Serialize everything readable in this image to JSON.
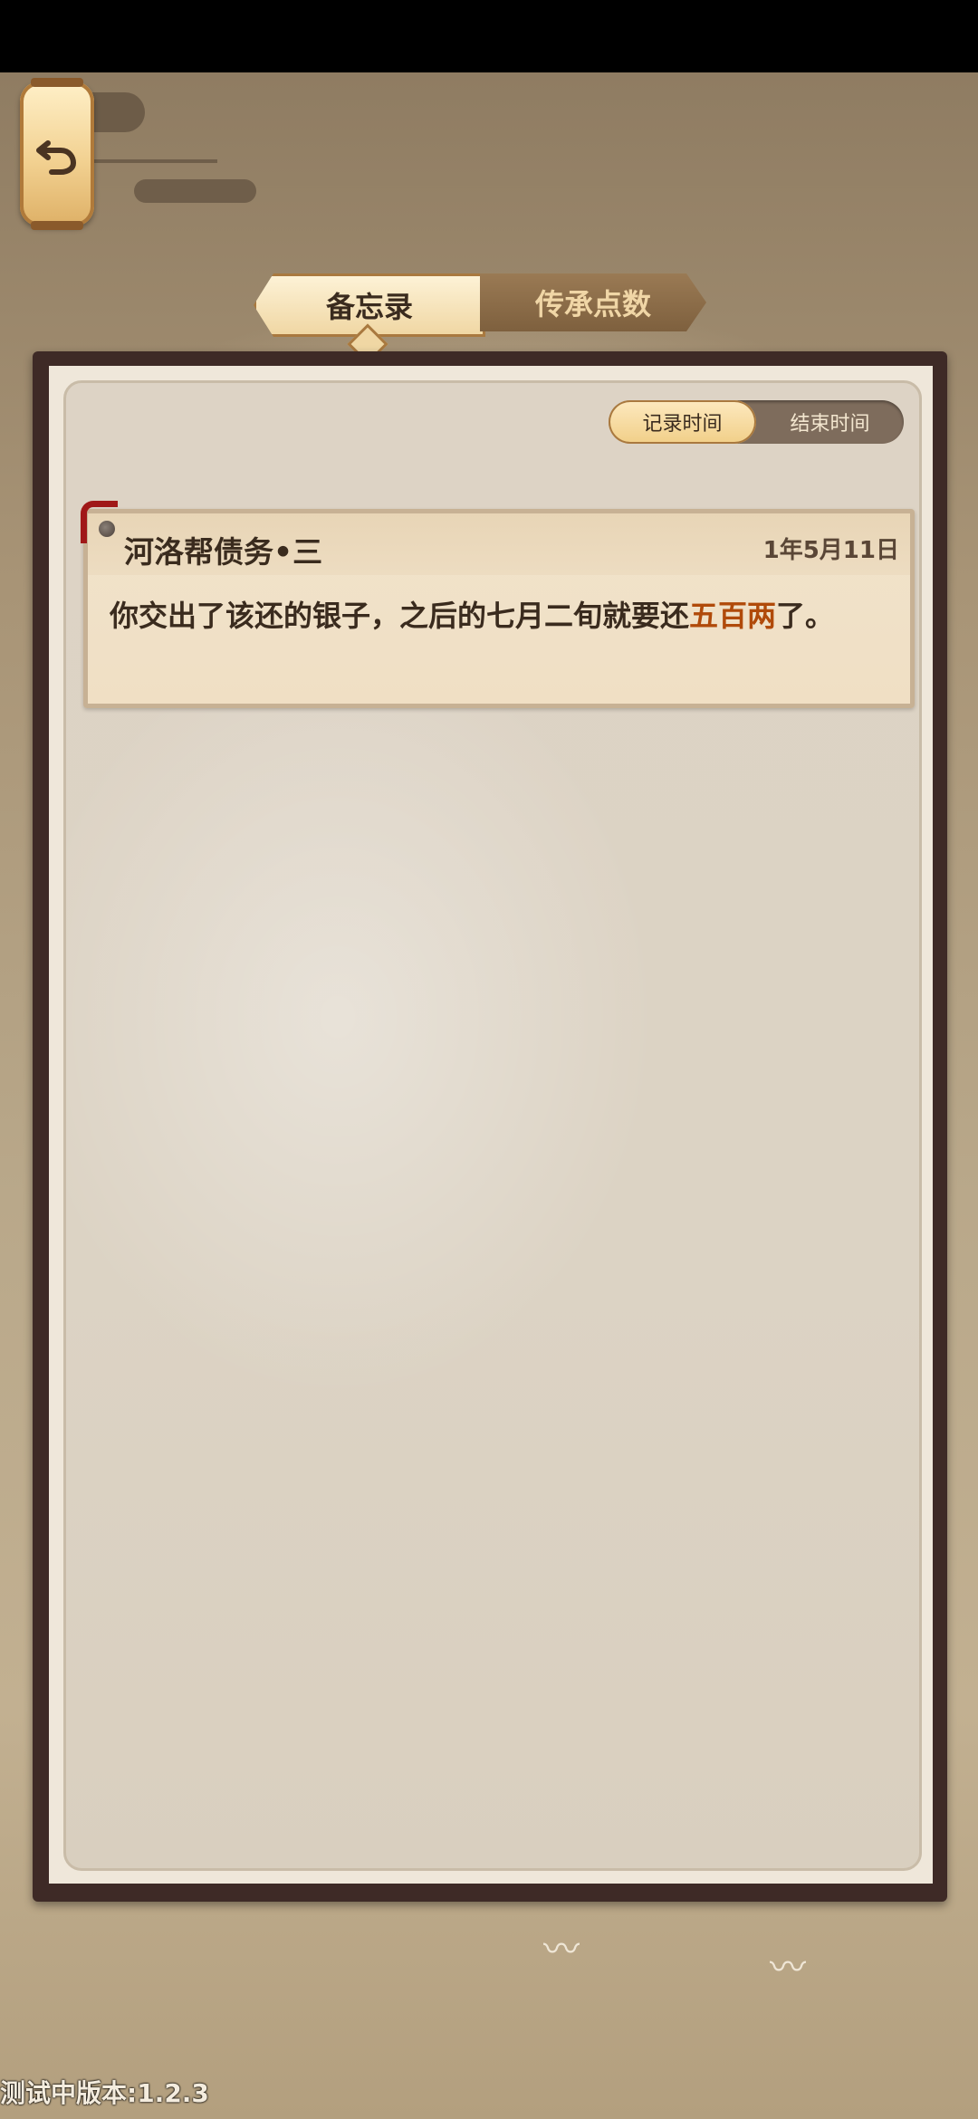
{
  "tabs": [
    {
      "label": "备忘录",
      "active": true
    },
    {
      "label": "传承点数",
      "active": false
    }
  ],
  "sort_toggle": {
    "options": [
      "记录时间",
      "结束时间"
    ],
    "selected": "记录时间"
  },
  "memo_entries": [
    {
      "title": "河洛帮债务•三",
      "date": "1年5月11日",
      "body_before": "你交出了该还的银子，之后的七月二旬就要还",
      "body_highlight": "五百两",
      "body_after": "了。"
    }
  ],
  "footer": {
    "version_text": "测试中版本:1.2.3"
  },
  "colors": {
    "highlight": "#b04a0a",
    "frame": "#3e2a26",
    "accent_gold": "#f0d7a4"
  },
  "icons": {
    "back": "back-arrow-icon"
  }
}
